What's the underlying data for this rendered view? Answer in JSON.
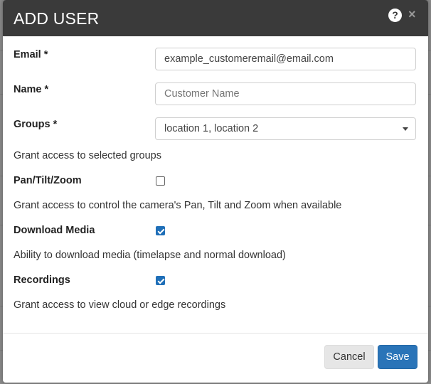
{
  "dialog": {
    "title": "ADD USER",
    "help_icon": "question-circle-icon",
    "close_icon": "close-icon",
    "close_glyph": "×",
    "help_glyph": "?"
  },
  "form": {
    "email": {
      "label": "Email *",
      "value": "example_customeremail@email.com"
    },
    "name": {
      "label": "Name *",
      "value": "",
      "placeholder": "Customer Name"
    },
    "groups": {
      "label": "Groups *",
      "selected": "location 1, location 2",
      "description": "Grant access to selected groups"
    },
    "ptz": {
      "label": "Pan/Tilt/Zoom",
      "checked": false,
      "description": "Grant access to control the camera's Pan, Tilt and Zoom when available"
    },
    "download_media": {
      "label": "Download Media",
      "checked": true,
      "description": "Ability to download media (timelapse and normal download)"
    },
    "recordings": {
      "label": "Recordings",
      "checked": true,
      "description": "Grant access to view cloud or edge recordings"
    }
  },
  "footer": {
    "cancel_label": "Cancel",
    "save_label": "Save"
  },
  "colors": {
    "header_bg": "#3a3a3a",
    "primary": "#2a74b8",
    "checkbox_checked": "#1f6fb8"
  }
}
